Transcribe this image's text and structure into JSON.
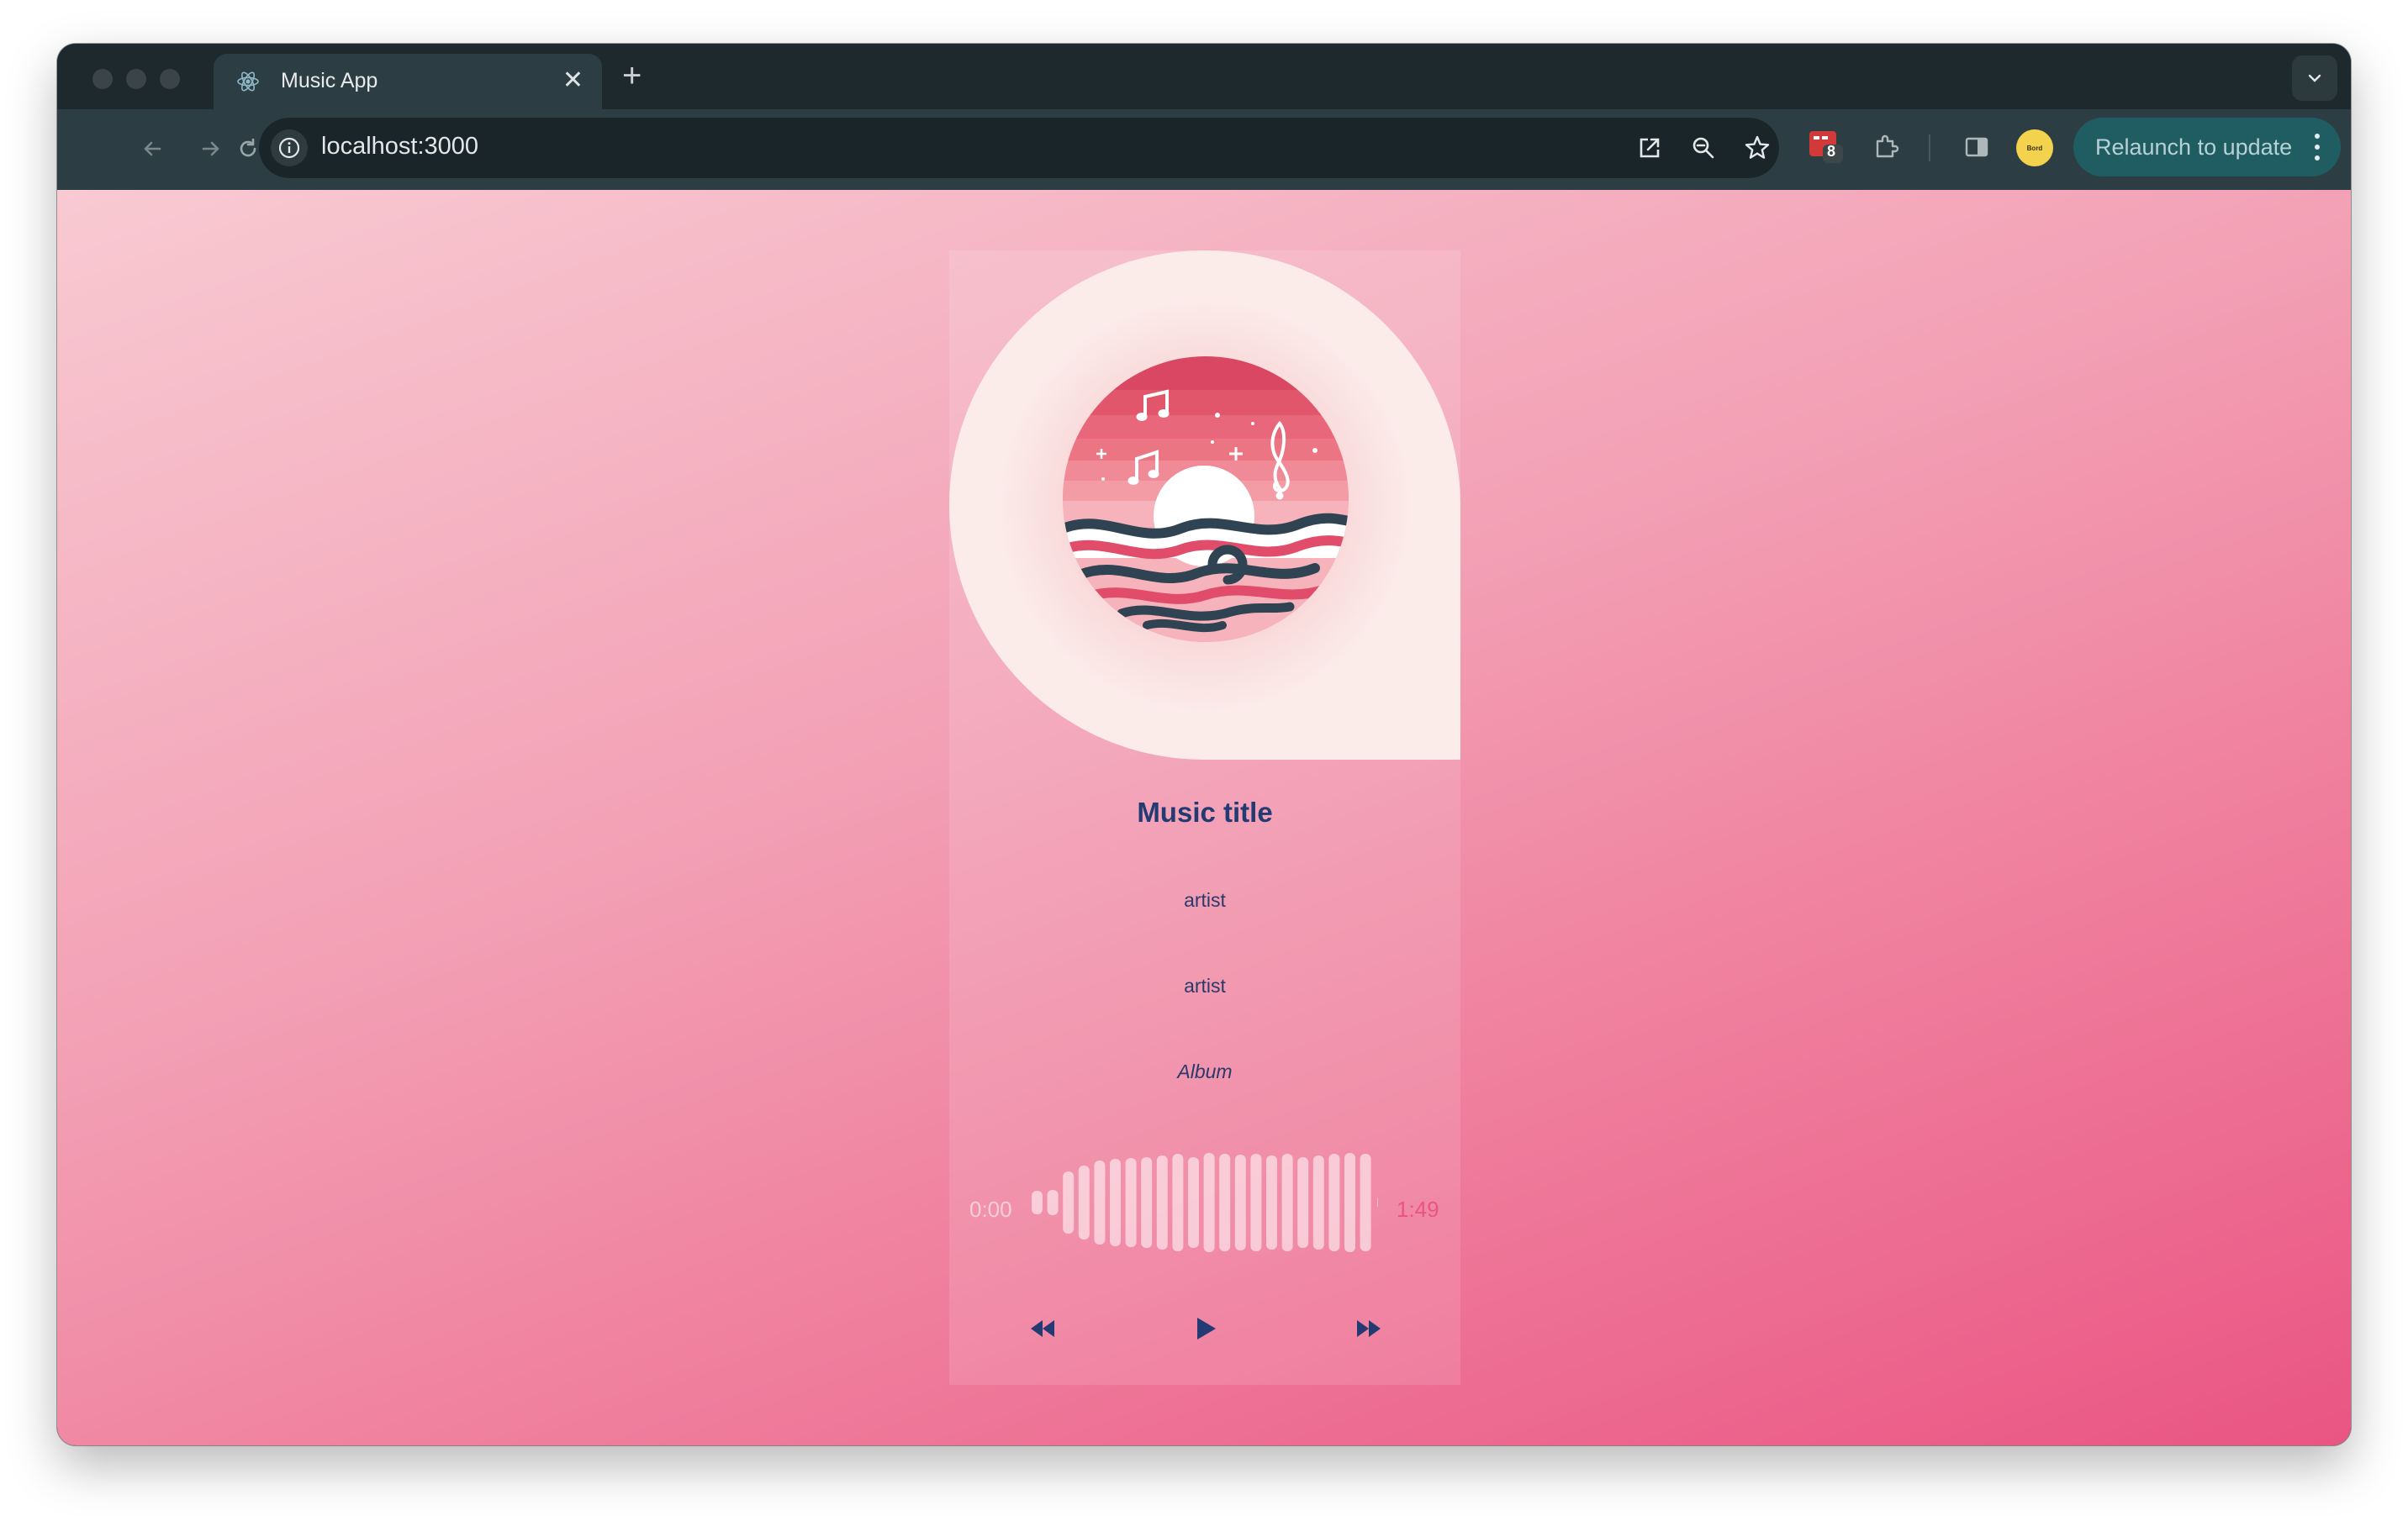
{
  "browser": {
    "tab_title": "Music App",
    "url": "localhost:3000",
    "extension_badge_count": "8",
    "relaunch_label": "Relaunch to update",
    "avatar_text": "Bord"
  },
  "player": {
    "title": "Music title",
    "artist_line_1": "artist",
    "artist_line_2": "artist",
    "album": "Album",
    "time_elapsed": "0:00",
    "time_total": "1:49",
    "progress": 0
  },
  "colors": {
    "accent": "#e9557d",
    "text_dark": "#233a73",
    "background_start": "#f8cad2",
    "background_end": "#ea5584"
  },
  "icons": [
    "react-icon",
    "close-icon",
    "plus-icon",
    "chevron-down-icon",
    "back-arrow-icon",
    "forward-arrow-icon",
    "reload-icon",
    "info-icon",
    "open-external-icon",
    "zoom-icon",
    "star-icon",
    "extension-icon",
    "puzzle-icon",
    "side-panel-icon",
    "kebab-menu-icon",
    "rewind-icon",
    "play-icon",
    "fast-forward-icon"
  ]
}
